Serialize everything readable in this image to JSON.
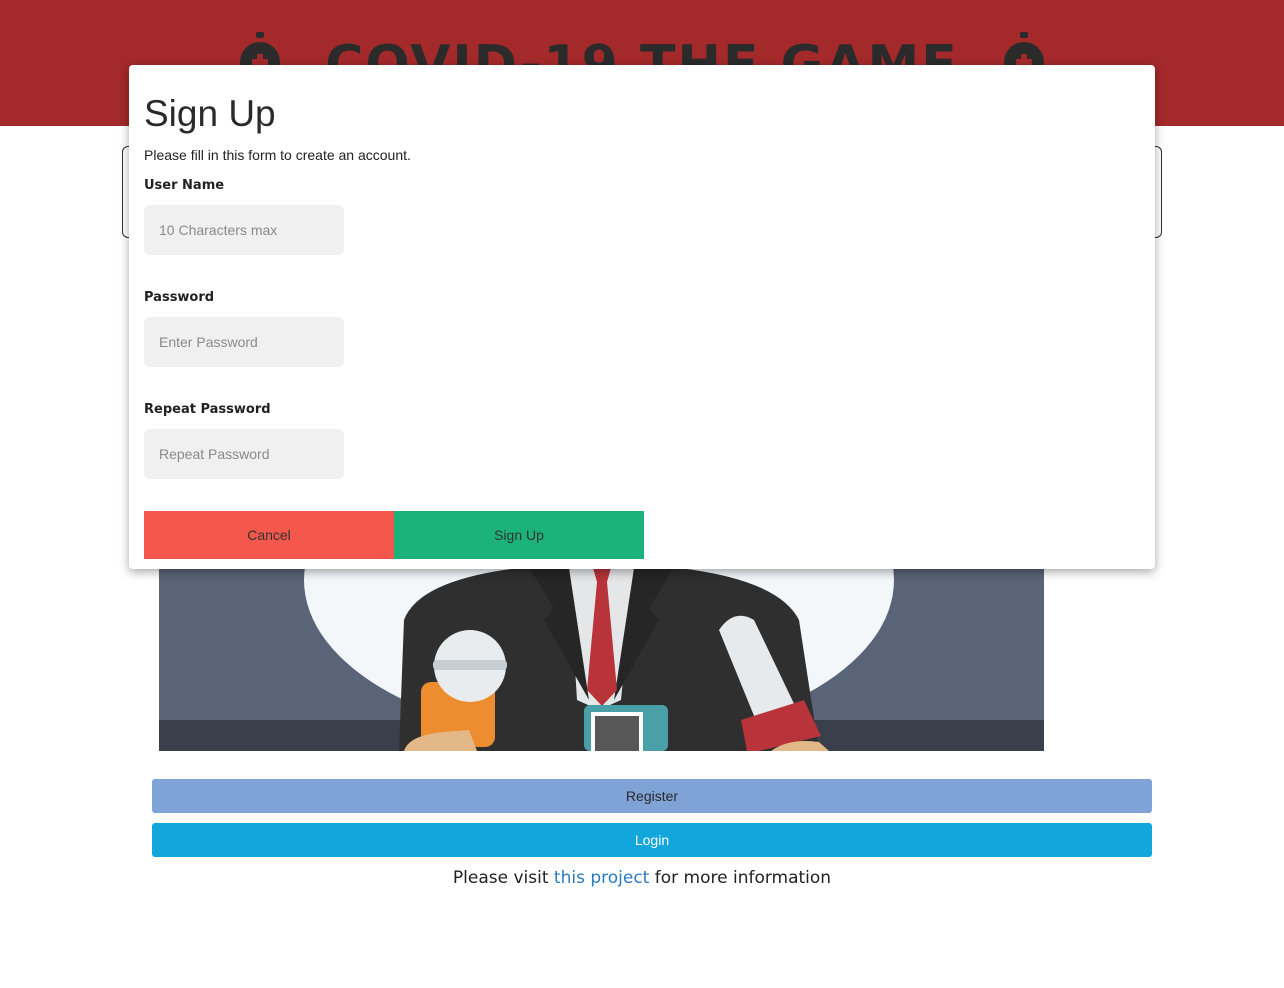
{
  "header": {
    "title": "COVID-19 THE GAME",
    "bg_color": "#a4292b",
    "icons": [
      "virus-icon",
      "virus-icon"
    ]
  },
  "modal": {
    "title": "Sign Up",
    "subtitle": "Please fill in this form to create an account.",
    "fields": {
      "username": {
        "label": "User Name",
        "placeholder": "10 Characters max"
      },
      "password": {
        "label": "Password",
        "placeholder": "Enter Password"
      },
      "repeat": {
        "label": "Repeat Password",
        "placeholder": "Repeat Password"
      }
    },
    "cancel_label": "Cancel",
    "signup_label": "Sign Up",
    "cancel_color": "#f4574b",
    "signup_color": "#1cb37b"
  },
  "main": {
    "illustration": "press-conference-illustration",
    "register_label": "Register",
    "login_label": "Login",
    "register_color": "#80a3d7",
    "login_color": "#12a6dc"
  },
  "footer": {
    "prefix": "Please visit ",
    "link_text": "this project",
    "suffix": " for more information"
  }
}
